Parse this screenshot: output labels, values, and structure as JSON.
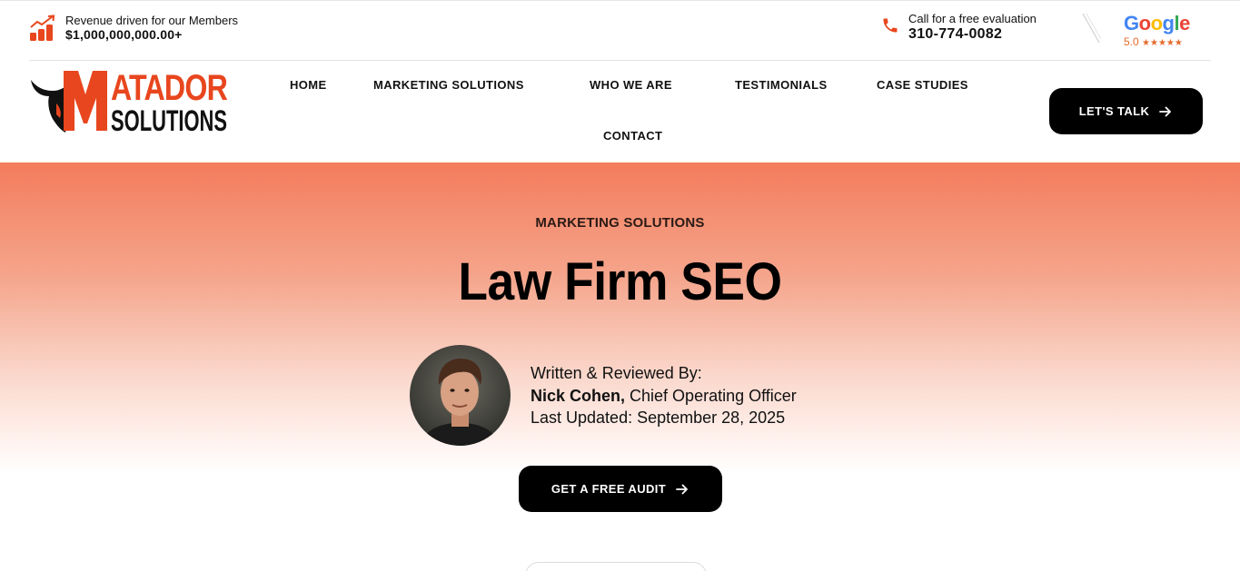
{
  "topbar": {
    "revenue_label": "Revenue driven for our Members",
    "revenue_value": "$1,000,000,000.00+",
    "call_label": "Call for a free evaluation",
    "phone": "310-774-0082",
    "google_wordmark": "Google",
    "google_rating": "5.0",
    "google_stars": "★★★★★"
  },
  "brand": {
    "logo_line1": "MATADOR",
    "logo_line2": "SOLUTIONS",
    "accent": "#e8461e",
    "dark": "#111111"
  },
  "nav": {
    "home": "HOME",
    "marketing": "MARKETING SOLUTIONS",
    "who": "WHO WE ARE",
    "testimonials": "TESTIMONIALS",
    "case_studies": "CASE STUDIES",
    "contact": "CONTACT",
    "cta": "LET'S TALK"
  },
  "hero": {
    "eyebrow": "MARKETING SOLUTIONS",
    "title": "Law Firm SEO",
    "written_by": "Written & Reviewed By:",
    "author_name": "Nick Cohen,",
    "author_role": " Chief Operating Officer",
    "updated": "Last Updated: September 28, 2025",
    "cta": "GET A FREE AUDIT",
    "gradient_top": "#f37c5c"
  },
  "icons": {
    "revenue": "bar-chart-growth-icon",
    "phone": "phone-icon",
    "arrow": "arrow-right-icon"
  }
}
